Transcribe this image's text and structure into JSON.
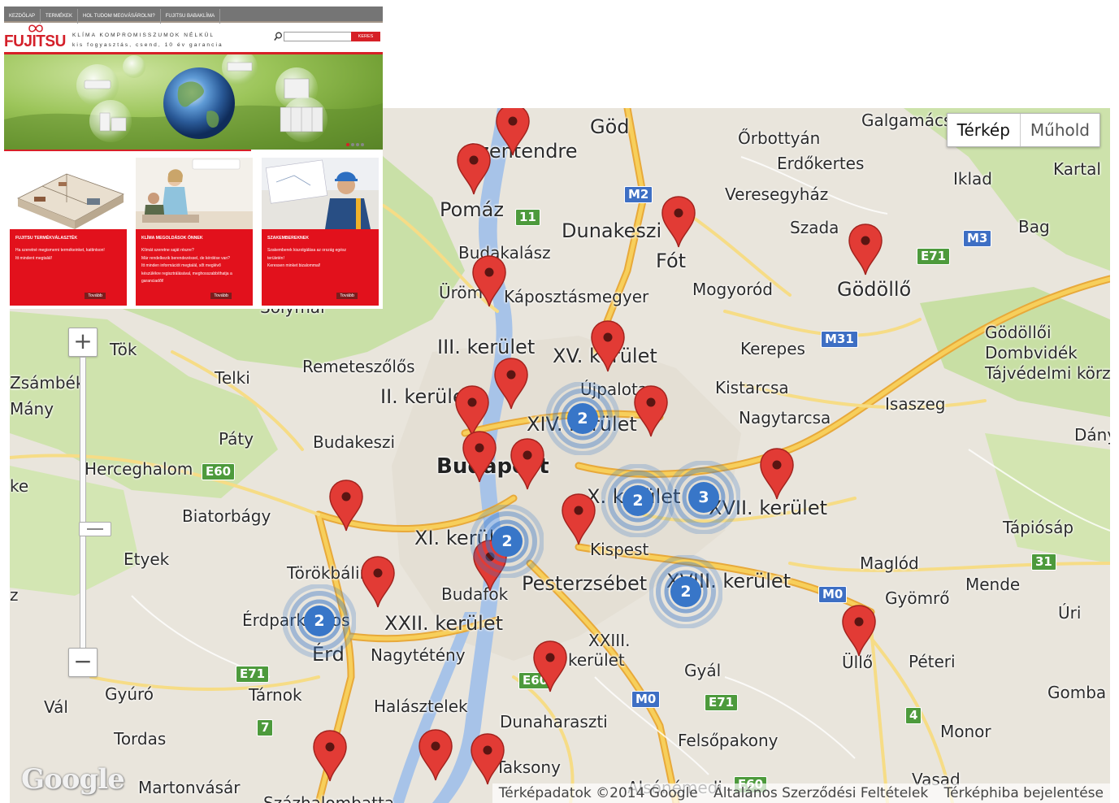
{
  "map": {
    "maptype_buttons": [
      "Térkép",
      "Műhold"
    ],
    "zoom_in": "+",
    "zoom_out": "−",
    "logo_text": "Google",
    "attribution": [
      "Térképadatok ©2014 Google",
      "Általános Szerződési Feltételek",
      "Térképhiba bejelentése"
    ],
    "places": [
      {
        "text": "Göd",
        "cls": "mid"
      },
      {
        "text": "Szentendre",
        "cls": "mid"
      },
      {
        "text": "Galgamácsa",
        "cls": ""
      },
      {
        "text": "Őrbottyán",
        "cls": ""
      },
      {
        "text": "Erdőkertes",
        "cls": ""
      },
      {
        "text": "Kartal",
        "cls": ""
      },
      {
        "text": "Iklad",
        "cls": ""
      },
      {
        "text": "Veresegyház",
        "cls": ""
      },
      {
        "text": "Pomáz",
        "cls": "mid"
      },
      {
        "text": "Dunakeszi",
        "cls": "mid"
      },
      {
        "text": "Szada",
        "cls": ""
      },
      {
        "text": "Bag",
        "cls": ""
      },
      {
        "text": "Budakalász",
        "cls": ""
      },
      {
        "text": "Fót",
        "cls": "mid"
      },
      {
        "text": "Üröm",
        "cls": ""
      },
      {
        "text": "Káposztásmegyer",
        "cls": ""
      },
      {
        "text": "Mogyoród",
        "cls": ""
      },
      {
        "text": "Gödöllő",
        "cls": "mid"
      },
      {
        "text": "Solymár",
        "cls": ""
      },
      {
        "text": "Gödöllői",
        "cls": ""
      },
      {
        "text": "Dombvidék",
        "cls": ""
      },
      {
        "text": "Tájvédelmi körz",
        "cls": ""
      },
      {
        "text": "III. kerület",
        "cls": "mid"
      },
      {
        "text": "XV. kerület",
        "cls": "mid"
      },
      {
        "text": "Kerepes",
        "cls": ""
      },
      {
        "text": "Tök",
        "cls": ""
      },
      {
        "text": "Remeteszőlős",
        "cls": ""
      },
      {
        "text": "Zsámbék",
        "cls": ""
      },
      {
        "text": "Telki",
        "cls": ""
      },
      {
        "text": "II. kerület",
        "cls": "mid"
      },
      {
        "text": "Újpalota",
        "cls": ""
      },
      {
        "text": "Kistarcsa",
        "cls": ""
      },
      {
        "text": "Isaszeg",
        "cls": ""
      },
      {
        "text": "Mány",
        "cls": ""
      },
      {
        "text": "XIV. kerület",
        "cls": "mid"
      },
      {
        "text": "Nagytarcsa",
        "cls": ""
      },
      {
        "text": "Páty",
        "cls": ""
      },
      {
        "text": "Budakeszi",
        "cls": ""
      },
      {
        "text": "Dány",
        "cls": ""
      },
      {
        "text": "Herceghalom",
        "cls": ""
      },
      {
        "text": "Budapest",
        "cls": "big"
      },
      {
        "text": "ke",
        "cls": ""
      },
      {
        "text": "X. kerület",
        "cls": "mid"
      },
      {
        "text": "XVII. kerület",
        "cls": "mid"
      },
      {
        "text": "Biatorbágy",
        "cls": ""
      },
      {
        "text": "Tápiósáp",
        "cls": ""
      },
      {
        "text": "XI. kerület",
        "cls": "mid"
      },
      {
        "text": "Kispest",
        "cls": ""
      },
      {
        "text": "Etyek",
        "cls": ""
      },
      {
        "text": "Maglód",
        "cls": ""
      },
      {
        "text": "Törökbálint",
        "cls": ""
      },
      {
        "text": "Mende",
        "cls": ""
      },
      {
        "text": "Pesterzsébet",
        "cls": "mid"
      },
      {
        "text": "Budafok",
        "cls": ""
      },
      {
        "text": "XVIII. kerület",
        "cls": "mid"
      },
      {
        "text": "Gyömrő",
        "cls": ""
      },
      {
        "text": "z",
        "cls": ""
      },
      {
        "text": "Úri",
        "cls": ""
      },
      {
        "text": "Érdparkváros",
        "cls": ""
      },
      {
        "text": "XXII. kerület",
        "cls": "mid"
      },
      {
        "text": "XXIII.",
        "cls": ""
      },
      {
        "text": "kerület",
        "cls": ""
      },
      {
        "text": "Érd",
        "cls": "mid"
      },
      {
        "text": "Nagytétény",
        "cls": ""
      },
      {
        "text": "Péteri",
        "cls": ""
      },
      {
        "text": "Üllő",
        "cls": ""
      },
      {
        "text": "Gyál",
        "cls": ""
      },
      {
        "text": "Gyúró",
        "cls": ""
      },
      {
        "text": "Tárnok",
        "cls": ""
      },
      {
        "text": "Gomba",
        "cls": ""
      },
      {
        "text": "Vál",
        "cls": ""
      },
      {
        "text": "Halásztelek",
        "cls": ""
      },
      {
        "text": "Dunaharaszti",
        "cls": ""
      },
      {
        "text": "Tordas",
        "cls": ""
      },
      {
        "text": "Felsőpakony",
        "cls": ""
      },
      {
        "text": "Monor",
        "cls": ""
      },
      {
        "text": "Taksony",
        "cls": ""
      },
      {
        "text": "Martonvásár",
        "cls": ""
      },
      {
        "text": "Vasad",
        "cls": ""
      },
      {
        "text": "Alsónémedi",
        "cls": ""
      },
      {
        "text": "Százhalombatta",
        "cls": ""
      }
    ],
    "road_shields": [
      {
        "label": "M2",
        "kind": "blue"
      },
      {
        "label": "11",
        "kind": "green"
      },
      {
        "label": "M3",
        "kind": "blue"
      },
      {
        "label": "E71",
        "kind": "green"
      },
      {
        "label": "M31",
        "kind": "blue"
      },
      {
        "label": "E60",
        "kind": "green"
      },
      {
        "label": "31",
        "kind": "green"
      },
      {
        "label": "M0",
        "kind": "blue"
      },
      {
        "label": "E71",
        "kind": "green"
      },
      {
        "label": "E60",
        "kind": "green"
      },
      {
        "label": "M0",
        "kind": "blue"
      },
      {
        "label": "E71",
        "kind": "green"
      },
      {
        "label": "7",
        "kind": "green"
      },
      {
        "label": "4",
        "kind": "green"
      },
      {
        "label": "E60",
        "kind": "green"
      }
    ],
    "markers_count": 21,
    "clusters": [
      {
        "count": "2"
      },
      {
        "count": "2"
      },
      {
        "count": "3"
      },
      {
        "count": "2"
      },
      {
        "count": "2"
      },
      {
        "count": "2"
      }
    ],
    "colors": {
      "marker": "#e23b35",
      "cluster": "#3876c8",
      "highway": "#f5c23b",
      "major_road": "#f6d473",
      "water": "#a7c3e8",
      "park": "#c6dfa5"
    }
  },
  "site": {
    "nav": [
      "KEZDŐLAP",
      "TERMÉKEK",
      "HOL TUDOM MEGVÁSÁROLNI?",
      "FUJITSU BABAKLÍMA"
    ],
    "logo": "FUJITSU",
    "tagline1": "KLÍMA KOMPROMISSZUMOK NÉLKÜL",
    "tagline2": "kis fogyasztás, csend, 10 év garancia",
    "search_button": "KERES",
    "cards": [
      {
        "title": "FUJITSU TERMÉKVÁLASZTÉK",
        "lines": [
          "Ha szeretné megismerni termékeinket, kattintson!",
          "Itt mindent megtalál!"
        ],
        "more": "Tovább"
      },
      {
        "title": "KLÍMA MEGOLDÁSOK ÖNNEK",
        "lines": [
          "Klímát szeretne saját részre?",
          "Már rendelkezik berendezéssel, de kérdése van?",
          "Itt minden információt megtalál, sőt meglévő",
          "készülékre regisztrálásával, meghosszabbíthatja a",
          "garanciadőt!"
        ],
        "more": "Tovább"
      },
      {
        "title": "SZAKEMBEREKNEK",
        "lines": [
          "Szakemberek kiszolgálása az ország egész",
          "területén!",
          "Keressen minket bizalommal!"
        ],
        "more": "Tovább"
      }
    ]
  }
}
